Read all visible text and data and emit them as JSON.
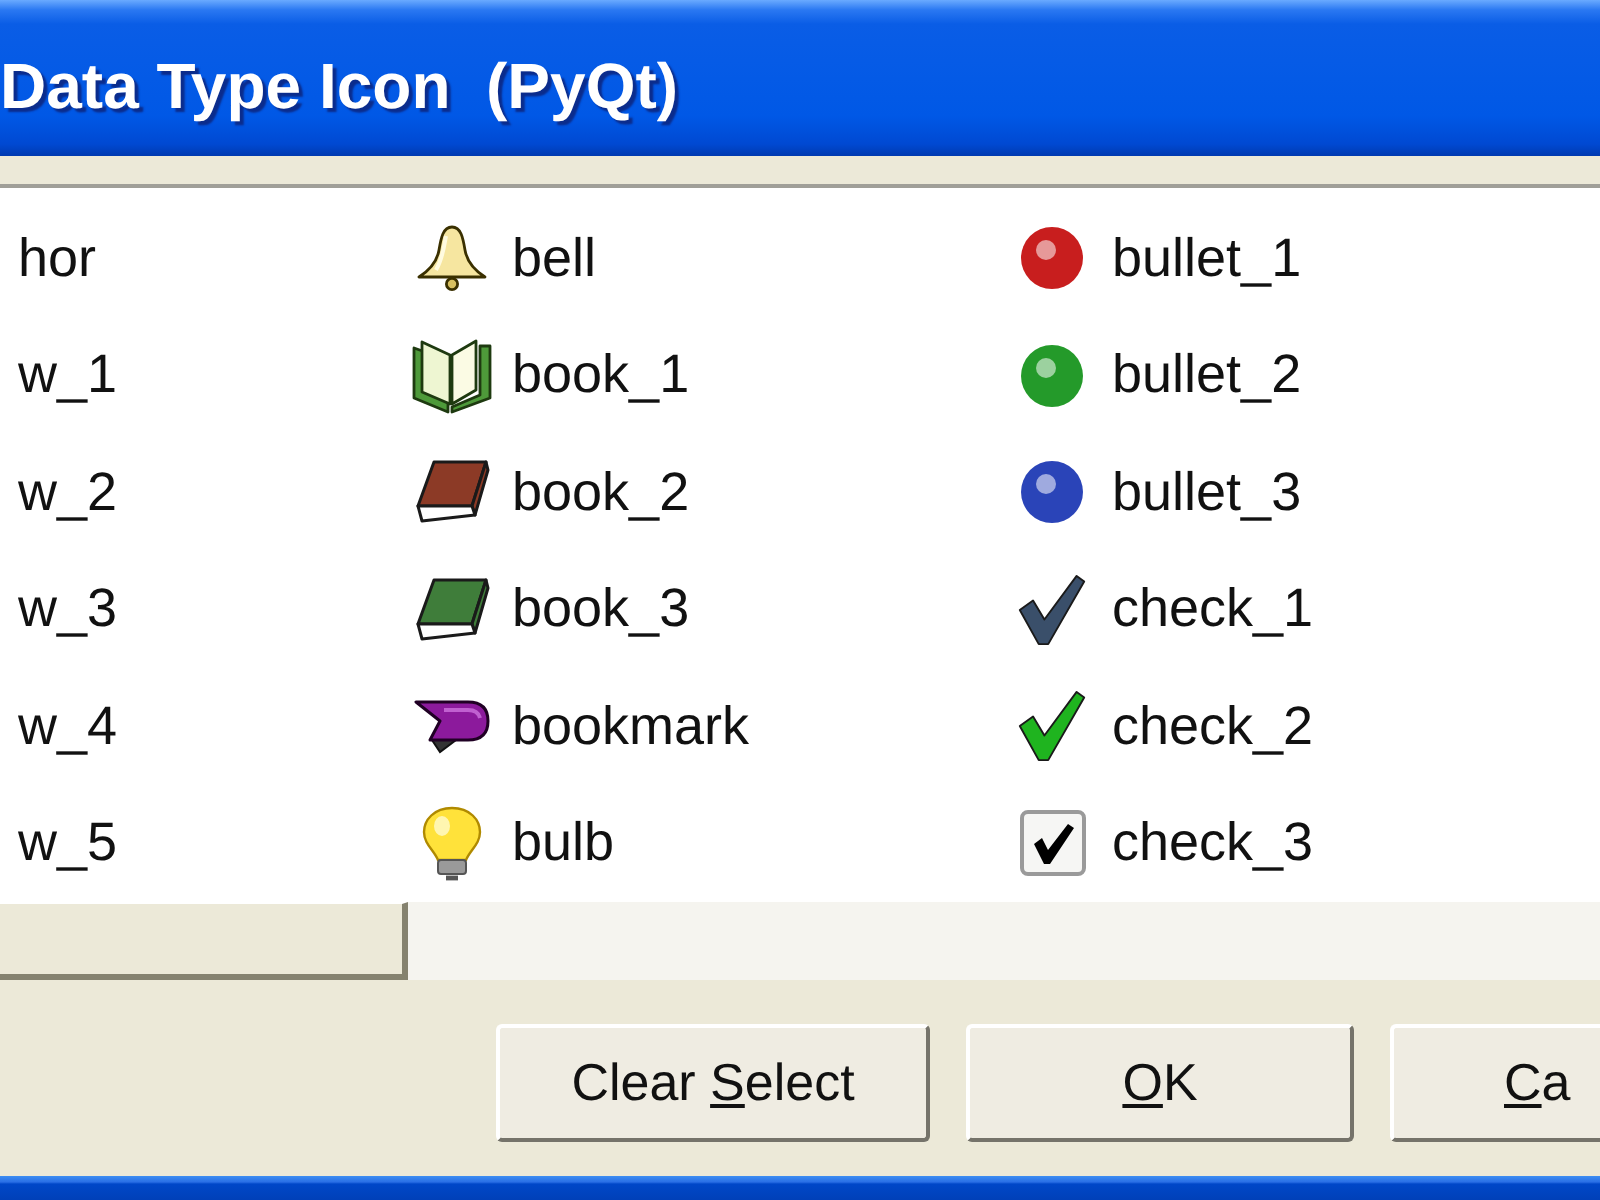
{
  "window": {
    "title": "Data Type Icon  (PyQt)"
  },
  "icon_list": {
    "columns": [
      {
        "items": [
          {
            "label": "hor",
            "selected": false
          },
          {
            "label": "w_1",
            "selected": false
          },
          {
            "label": "w_2",
            "selected": false
          },
          {
            "label": "w_3",
            "selected": false
          },
          {
            "label": "w_4",
            "selected": false
          },
          {
            "label": "w_5",
            "selected": false
          }
        ]
      },
      {
        "items": [
          {
            "label": "bell",
            "kind": "bell",
            "selected": false
          },
          {
            "label": "book_1",
            "kind": "openbook",
            "selected": false
          },
          {
            "label": "book_2",
            "kind": "book",
            "color": "#8c3a26",
            "selected": false
          },
          {
            "label": "book_3",
            "kind": "book",
            "color": "#3f7d3a",
            "selected": false
          },
          {
            "label": "bookmark",
            "kind": "bookmark",
            "selected": false
          },
          {
            "label": "bulb",
            "kind": "bulb",
            "selected": false
          }
        ]
      },
      {
        "items": [
          {
            "label": "bullet_1",
            "kind": "ball",
            "color": "#c81e1e",
            "selected": false
          },
          {
            "label": "bullet_2",
            "kind": "ball",
            "color": "#249a2a",
            "selected": false
          },
          {
            "label": "bullet_3",
            "kind": "ball",
            "color": "#2a44b8",
            "selected": false
          },
          {
            "label": "check_1",
            "kind": "tick",
            "color": "#3a4f6a",
            "selected": false
          },
          {
            "label": "check_2",
            "kind": "tick",
            "color": "#1fb41f",
            "selected": false
          },
          {
            "label": "check_3",
            "kind": "checkbox",
            "selected": false
          }
        ]
      }
    ]
  },
  "buttons": [
    {
      "label": [
        {
          "text": "Clear ",
          "underlined": false
        },
        {
          "text": "S",
          "underlined": true
        },
        {
          "text": "elect",
          "underlined": false
        }
      ]
    },
    {
      "label": [
        {
          "text": "O",
          "underlined": true
        },
        {
          "text": "K",
          "underlined": false
        }
      ]
    },
    {
      "label": [
        {
          "text": "C",
          "underlined": true
        },
        {
          "text": "a",
          "underlined": false
        }
      ]
    }
  ]
}
